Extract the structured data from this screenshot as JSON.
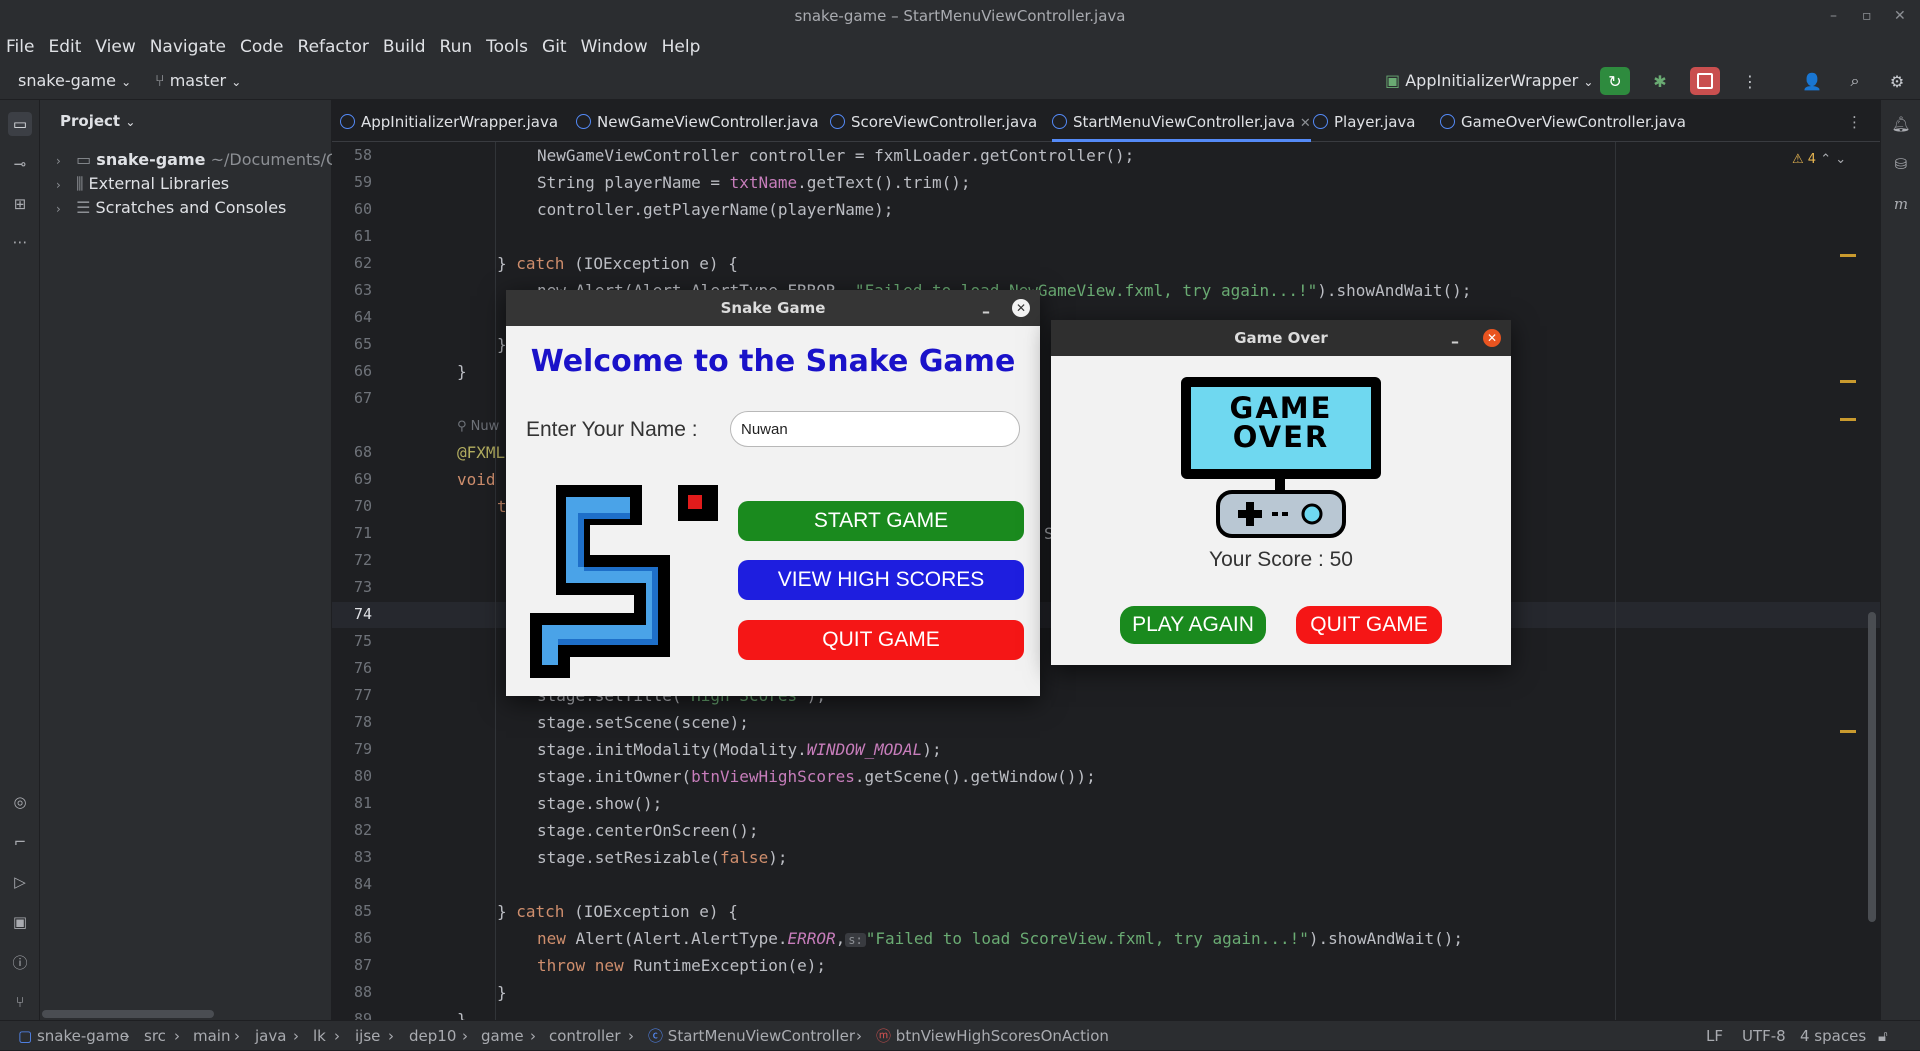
{
  "window": {
    "title": "snake-game – StartMenuViewController.java"
  },
  "menu": [
    "File",
    "Edit",
    "View",
    "Navigate",
    "Code",
    "Refactor",
    "Build",
    "Run",
    "Tools",
    "Git",
    "Window",
    "Help"
  ],
  "toolbar": {
    "project": "snake-game",
    "branch": "master",
    "run_config": "AppInitializerWrapper"
  },
  "project_panel": {
    "title": "Project",
    "items": [
      {
        "label": "snake-game",
        "path": "~/Documents/Git/"
      },
      {
        "label": "External Libraries"
      },
      {
        "label": "Scratches and Consoles"
      }
    ]
  },
  "tabs": [
    {
      "label": "AppInitializerWrapper.java"
    },
    {
      "label": "NewGameViewController.java"
    },
    {
      "label": "ScoreViewController.java"
    },
    {
      "label": "StartMenuViewController.java"
    },
    {
      "label": "Player.java"
    },
    {
      "label": "GameOverViewController.java"
    }
  ],
  "editor": {
    "warnings": "4",
    "lines": {
      "l58": "58",
      "l59": "59",
      "l60": "60",
      "l61": "61",
      "l62": "62",
      "l63": "63",
      "l64": "64",
      "l65": "65",
      "l66": "66",
      "l67": "67",
      "l68": "68",
      "l69": "69",
      "l70": "70",
      "l71": "71",
      "l72": "72",
      "l73": "73",
      "l74": "74",
      "l75": "75",
      "l76": "76",
      "l77": "77",
      "l78": "78",
      "l79": "79",
      "l80": "80",
      "l81": "81",
      "l82": "82",
      "l83": "83",
      "l84": "84",
      "l85": "85",
      "l86": "86",
      "l87": "87",
      "l88": "88",
      "l89": "89"
    },
    "code": {
      "c58": "NewGameViewController controller = fxmlLoader.getController();",
      "c59a": "String playerName = ",
      "c59b": "txtName",
      "c59c": ".getText().trim();",
      "c60": "controller.getPlayerName(playerName);",
      "c62a": "} ",
      "c62b": "catch",
      "c62c": " (IOException e) {",
      "c63a": "new Alert(Alert.AlertType.ERROR, ",
      "c63b": "\"Failed to load NewGameView.fxml, try again...!\"",
      "c63c": ").showAndWait();",
      "c65": "}",
      "c66": "}",
      "c67author": "Nuw",
      "c68": "@FXML",
      "c69": "void",
      "c70": "t",
      "c71s": "S",
      "c77a": "stage.setTitle(",
      "c77b": "\"High Scores\"",
      "c77c": ");",
      "c78": "stage.setScene(scene);",
      "c79a": "stage.initModality(Modality.",
      "c79b": "WINDOW_MODAL",
      "c79c": ");",
      "c80a": "stage.initOwner(",
      "c80b": "btnViewHighScores",
      "c80c": ".getScene().getWindow());",
      "c81": "stage.show();",
      "c82": "stage.centerOnScreen();",
      "c83a": "stage.setResizable(",
      "c83b": "false",
      "c83c": ");",
      "c85a": "} ",
      "c85b": "catch",
      "c85c": " (IOException e) {",
      "c86a": "new",
      "c86b": " Alert(Alert.AlertType.",
      "c86c": "ERROR",
      "c86d": ",",
      "c86hint": "s:",
      "c86e": "\"Failed to load ScoreView.fxml, try again...!\"",
      "c86f": ").showAndWait();",
      "c87a": "throw new",
      "c87b": " RuntimeException(e);",
      "c88": "}",
      "c89": "}"
    }
  },
  "statusbar": {
    "crumbs": [
      "snake-game",
      "src",
      "main",
      "java",
      "lk",
      "ijse",
      "dep10",
      "game",
      "controller",
      "StartMenuViewController",
      "btnViewHighScoresOnAction"
    ],
    "line_sep": "LF",
    "encoding": "UTF-8",
    "indent": "4 spaces"
  },
  "snake_dialog": {
    "title": "Snake Game",
    "heading": "Welcome to the Snake Game",
    "name_label": "Enter Your Name :",
    "name_value": "Nuwan",
    "start_label": "START GAME",
    "scores_label": "VIEW HIGH SCORES",
    "quit_label": "QUIT GAME"
  },
  "gameover_dialog": {
    "title": "Game Over",
    "logo_line1": "GAME",
    "logo_line2": "OVER",
    "score_text": "Your Score : 50",
    "play_again_label": "PLAY AGAIN",
    "quit_label": "QUIT GAME"
  },
  "colors": {
    "green": "#1a8a1e",
    "blue": "#1e1edf",
    "red": "#f51616",
    "heading": "#1a12c9"
  }
}
